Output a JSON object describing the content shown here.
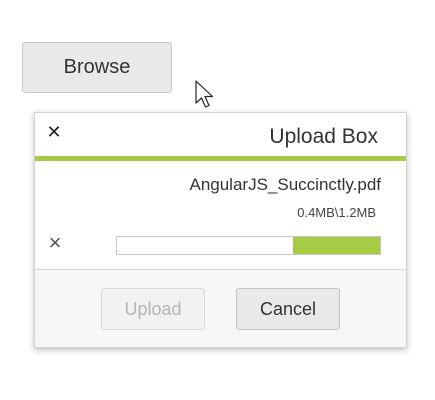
{
  "browse_button": {
    "label": "Browse"
  },
  "upload_box": {
    "title": "Upload Box",
    "close_icon": "close-icon",
    "accent_color": "#a6cc45",
    "file": {
      "name": "AngularJS_Succinctly.pdf",
      "size_text": "0.4MB\\1.2MB",
      "progress_fraction": 0.33,
      "remove_icon": "remove-icon"
    },
    "footer": {
      "upload_label": "Upload",
      "upload_enabled": false,
      "cancel_label": "Cancel"
    }
  },
  "cursor_icon": "mouse-pointer-icon"
}
